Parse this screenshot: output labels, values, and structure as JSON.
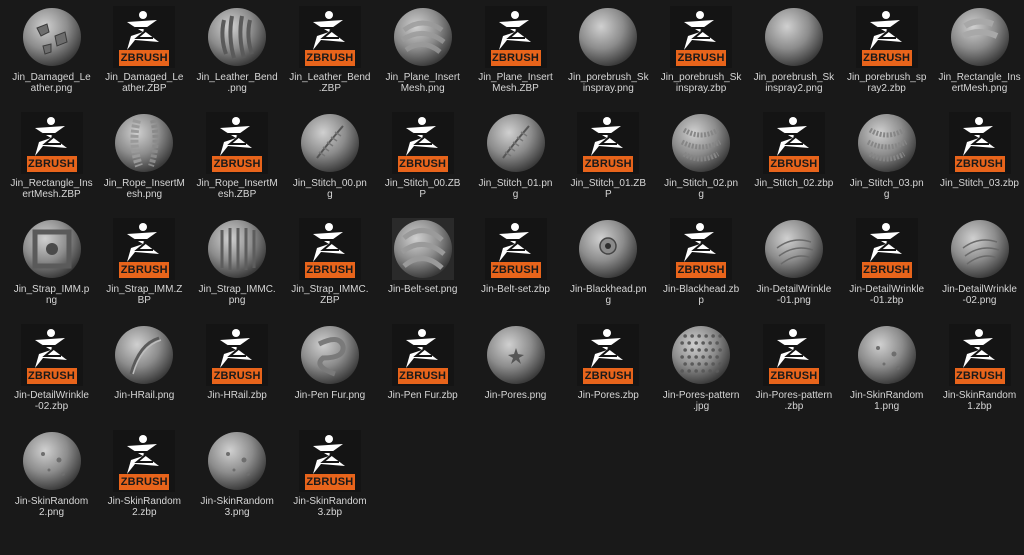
{
  "files": [
    {
      "name": "Jin_Damaged_Leather.png",
      "label_lines": [
        "Jin_Damaged_Le",
        "ather.png"
      ],
      "kind": "png",
      "icon": "damaged-leather-sphere"
    },
    {
      "name": "Jin_Damaged_Leather.ZBP",
      "label_lines": [
        "Jin_Damaged_Le",
        "ather.ZBP"
      ],
      "kind": "zbp",
      "icon": "zbrush-logo"
    },
    {
      "name": "Jin_Leather_Bend.png",
      "label_lines": [
        "Jin_Leather_Bend",
        ".png"
      ],
      "kind": "png",
      "icon": "leather-bend-sphere"
    },
    {
      "name": "Jin_Leather_Bend.ZBP",
      "label_lines": [
        "Jin_Leather_Bend",
        ".ZBP"
      ],
      "kind": "zbp",
      "icon": "zbrush-logo"
    },
    {
      "name": "Jin_Plane_InsertMesh.png",
      "label_lines": [
        "Jin_Plane_Insert",
        "Mesh.png"
      ],
      "kind": "png",
      "icon": "plane-insert-sphere"
    },
    {
      "name": "Jin_Plane_InsertMesh.ZBP",
      "label_lines": [
        "Jin_Plane_Insert",
        "Mesh.ZBP"
      ],
      "kind": "zbp",
      "icon": "zbrush-logo"
    },
    {
      "name": "Jin_porebrush_Skinspray.png",
      "label_lines": [
        "Jin_porebrush_Sk",
        "inspray.png"
      ],
      "kind": "png",
      "icon": "skinspray-sphere"
    },
    {
      "name": "Jin_porebrush_Skinspray.zbp",
      "label_lines": [
        "Jin_porebrush_Sk",
        "inspray.zbp"
      ],
      "kind": "zbp",
      "icon": "zbrush-logo"
    },
    {
      "name": "Jin_porebrush_Skinspray2.png",
      "label_lines": [
        "Jin_porebrush_Sk",
        "inspray2.png"
      ],
      "kind": "png",
      "icon": "skinspray-sphere"
    },
    {
      "name": "Jin_porebrush_spray2.zbp",
      "label_lines": [
        "Jin_porebrush_sp",
        "ray2.zbp"
      ],
      "kind": "zbp",
      "icon": "zbrush-logo"
    },
    {
      "name": "Jin_Rectangle_InsertMesh.png",
      "label_lines": [
        "Jin_Rectangle_Ins",
        "ertMesh.png"
      ],
      "kind": "png",
      "icon": "rectangle-insert-sphere"
    },
    {
      "name": "Jin_Rectangle_InsertMesh.ZBP",
      "label_lines": [
        "Jin_Rectangle_Ins",
        "ertMesh.ZBP"
      ],
      "kind": "zbp",
      "icon": "zbrush-logo"
    },
    {
      "name": "Jin_Rope_InsertMesh.png",
      "label_lines": [
        "Jin_Rope_InsertM",
        "esh.png"
      ],
      "kind": "png",
      "icon": "rope-sphere"
    },
    {
      "name": "Jin_Rope_InsertMesh.ZBP",
      "label_lines": [
        "Jin_Rope_InsertM",
        "esh.ZBP"
      ],
      "kind": "zbp",
      "icon": "zbrush-logo"
    },
    {
      "name": "Jin_Stitch_00.png",
      "label_lines": [
        "Jin_Stitch_00.pn",
        "g"
      ],
      "kind": "png",
      "icon": "stitch-sphere"
    },
    {
      "name": "Jin_Stitch_00.ZBP",
      "label_lines": [
        "Jin_Stitch_00.ZB",
        "P"
      ],
      "kind": "zbp",
      "icon": "zbrush-logo"
    },
    {
      "name": "Jin_Stitch_01.png",
      "label_lines": [
        "Jin_Stitch_01.pn",
        "g"
      ],
      "kind": "png",
      "icon": "stitch-sphere"
    },
    {
      "name": "Jin_Stitch_01.ZBP",
      "label_lines": [
        "Jin_Stitch_01.ZB",
        "P"
      ],
      "kind": "zbp",
      "icon": "zbrush-logo"
    },
    {
      "name": "Jin_Stitch_02.png",
      "label_lines": [
        "Jin_Stitch_02.pn",
        "g"
      ],
      "kind": "png",
      "icon": "stitch-bands-sphere"
    },
    {
      "name": "Jin_Stitch_02.zbp",
      "label_lines": [
        "Jin_Stitch_02.zbp"
      ],
      "kind": "zbp",
      "icon": "zbrush-logo"
    },
    {
      "name": "Jin_Stitch_03.png",
      "label_lines": [
        "Jin_Stitch_03.pn",
        "g"
      ],
      "kind": "png",
      "icon": "stitch-bands-sphere"
    },
    {
      "name": "Jin_Stitch_03.zbp",
      "label_lines": [
        "Jin_Stitch_03.zbp"
      ],
      "kind": "zbp",
      "icon": "zbrush-logo"
    },
    {
      "name": "Jin_Strap_IMM.png",
      "label_lines": [
        "Jin_Strap_IMM.p",
        "ng"
      ],
      "kind": "png",
      "icon": "strap-imm-sphere"
    },
    {
      "name": "Jin_Strap_IMM.ZBP",
      "label_lines": [
        "Jin_Strap_IMM.Z",
        "BP"
      ],
      "kind": "zbp",
      "icon": "zbrush-logo"
    },
    {
      "name": "Jin_Strap_IMMC.png",
      "label_lines": [
        "Jin_Strap_IMMC.",
        "png"
      ],
      "kind": "png",
      "icon": "strap-immc-sphere"
    },
    {
      "name": "Jin_Strap_IMMC.ZBP",
      "label_lines": [
        "Jin_Strap_IMMC.",
        "ZBP"
      ],
      "kind": "zbp",
      "icon": "zbrush-logo"
    },
    {
      "name": "Jin-Belt-set.png",
      "label_lines": [
        "Jin-Belt-set.png"
      ],
      "kind": "png",
      "icon": "belt-set-image"
    },
    {
      "name": "Jin-Belt-set.zbp",
      "label_lines": [
        "Jin-Belt-set.zbp"
      ],
      "kind": "zbp",
      "icon": "zbrush-logo"
    },
    {
      "name": "Jin-Blackhead.png",
      "label_lines": [
        "Jin-Blackhead.pn",
        "g"
      ],
      "kind": "png",
      "icon": "blackhead-sphere"
    },
    {
      "name": "Jin-Blackhead.zbp",
      "label_lines": [
        "Jin-Blackhead.zb",
        "p"
      ],
      "kind": "zbp",
      "icon": "zbrush-logo"
    },
    {
      "name": "Jin-DetailWrinkle-01.png",
      "label_lines": [
        "Jin-DetailWrinkle",
        "-01.png"
      ],
      "kind": "png",
      "icon": "wrinkle-sphere"
    },
    {
      "name": "Jin-DetailWrinkle-01.zbp",
      "label_lines": [
        "Jin-DetailWrinkle",
        "-01.zbp"
      ],
      "kind": "zbp",
      "icon": "zbrush-logo"
    },
    {
      "name": "Jin-DetailWrinkle-02.png",
      "label_lines": [
        "Jin-DetailWrinkle",
        "-02.png"
      ],
      "kind": "png",
      "icon": "wrinkle-sphere"
    },
    {
      "name": "Jin-DetailWrinkle-02.zbp",
      "label_lines": [
        "Jin-DetailWrinkle",
        "-02.zbp"
      ],
      "kind": "zbp",
      "icon": "zbrush-logo"
    },
    {
      "name": "Jin-HRail.png",
      "label_lines": [
        "Jin-HRail.png"
      ],
      "kind": "png",
      "icon": "hrail-sphere"
    },
    {
      "name": "Jin-HRail.zbp",
      "label_lines": [
        "Jin-HRail.zbp"
      ],
      "kind": "zbp",
      "icon": "zbrush-logo"
    },
    {
      "name": "Jin-Pen Fur.png",
      "label_lines": [
        "Jin-Pen Fur.png"
      ],
      "kind": "png",
      "icon": "pen-fur-sphere"
    },
    {
      "name": "Jin-Pen Fur.zbp",
      "label_lines": [
        "Jin-Pen Fur.zbp"
      ],
      "kind": "zbp",
      "icon": "zbrush-logo"
    },
    {
      "name": "Jin-Pores.png",
      "label_lines": [
        "Jin-Pores.png"
      ],
      "kind": "png",
      "icon": "pores-sphere"
    },
    {
      "name": "Jin-Pores.zbp",
      "label_lines": [
        "Jin-Pores.zbp"
      ],
      "kind": "zbp",
      "icon": "zbrush-logo"
    },
    {
      "name": "Jin-Pores-pattern.jpg",
      "label_lines": [
        "Jin-Pores-pattern",
        ".jpg"
      ],
      "kind": "png",
      "icon": "pores-pattern-sphere"
    },
    {
      "name": "Jin-Pores-pattern.zbp",
      "label_lines": [
        "Jin-Pores-pattern",
        ".zbp"
      ],
      "kind": "zbp",
      "icon": "zbrush-logo"
    },
    {
      "name": "Jin-SkinRandom1.png",
      "label_lines": [
        "Jin-SkinRandom",
        "1.png"
      ],
      "kind": "png",
      "icon": "skin-random-sphere"
    },
    {
      "name": "Jin-SkinRandom1.zbp",
      "label_lines": [
        "Jin-SkinRandom",
        "1.zbp"
      ],
      "kind": "zbp",
      "icon": "zbrush-logo"
    },
    {
      "name": "Jin-SkinRandom2.png",
      "label_lines": [
        "Jin-SkinRandom",
        "2.png"
      ],
      "kind": "png",
      "icon": "skin-random-sphere"
    },
    {
      "name": "Jin-SkinRandom2.zbp",
      "label_lines": [
        "Jin-SkinRandom",
        "2.zbp"
      ],
      "kind": "zbp",
      "icon": "zbrush-logo"
    },
    {
      "name": "Jin-SkinRandom3.png",
      "label_lines": [
        "Jin-SkinRandom",
        "3.png"
      ],
      "kind": "png",
      "icon": "skin-random-sphere"
    },
    {
      "name": "Jin-SkinRandom3.zbp",
      "label_lines": [
        "Jin-SkinRandom",
        "3.zbp"
      ],
      "kind": "zbp",
      "icon": "zbrush-logo"
    }
  ],
  "zbrush_badge_text": "ZBRUSH",
  "colors": {
    "background": "#191919",
    "zbrush_orange": "#e8641b",
    "zbrush_icon_bg": "#141414",
    "label_text": "#d6d6d6"
  }
}
